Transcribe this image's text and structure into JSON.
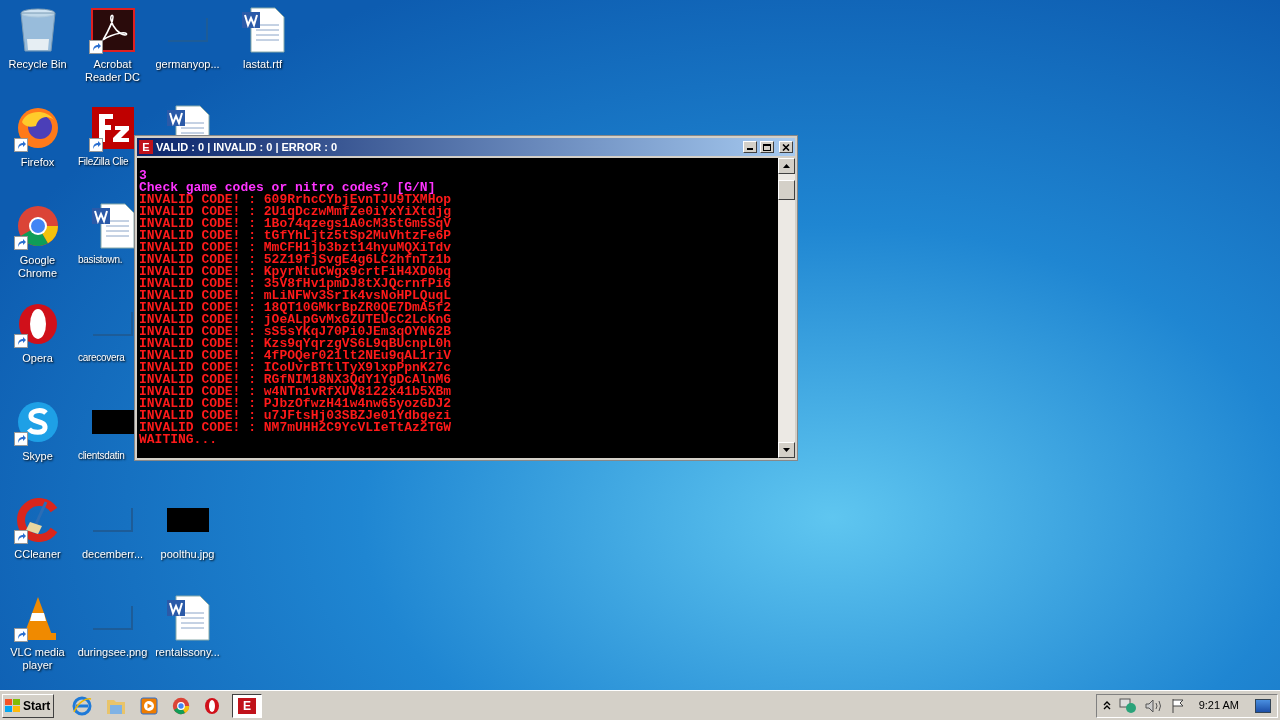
{
  "desktop": {
    "rows": [
      [
        {
          "kind": "recycle",
          "label": "Recycle Bin",
          "shortcut": false
        },
        {
          "kind": "pdf",
          "label": "Acrobat Reader DC",
          "shortcut": true
        },
        {
          "kind": "blank-thumb",
          "label": "germanyop..."
        },
        {
          "kind": "doc",
          "label": "lastat.rtf",
          "shortcut": false
        }
      ],
      [
        {
          "kind": "firefox",
          "label": "Firefox",
          "shortcut": true
        },
        {
          "kind": "fz",
          "label": "FileZilla Clie",
          "shortcut": true
        },
        {
          "kind": "doc",
          "shortcut": false
        },
        null
      ],
      [
        {
          "kind": "chrome",
          "label": "Google Chrome",
          "shortcut": true
        },
        {
          "kind": "doc",
          "label": "basistown.",
          "shortcut": false
        },
        null,
        null
      ],
      [
        {
          "kind": "opera",
          "label": "Opera",
          "shortcut": true
        },
        {
          "kind": "blank-thumb",
          "label": "carecovera"
        },
        null,
        null
      ],
      [
        {
          "kind": "skype",
          "label": "Skype",
          "shortcut": true
        },
        {
          "kind": "dark-thumb",
          "label": "clientsdatin"
        },
        null,
        null
      ],
      [
        {
          "kind": "ccleaner",
          "label": "CCleaner",
          "shortcut": true
        },
        {
          "kind": "blank-thumb",
          "label": "decemberr..."
        },
        {
          "kind": "dark-thumb",
          "label": "poolthu.jpg"
        },
        null
      ],
      [
        {
          "kind": "vlc",
          "label": "VLC media player",
          "shortcut": true
        },
        {
          "kind": "blank-thumb",
          "label": "duringsee.png"
        },
        {
          "kind": "doc",
          "label": "rentalssony...",
          "shortcut": false
        },
        null
      ]
    ]
  },
  "console": {
    "title_icon": "E",
    "title": "VALID : 0 | INVALID : 0 | ERROR : 0",
    "lines": [
      {
        "kind": "prompt",
        "text": "3"
      },
      {
        "kind": "prompt",
        "text": "Check game codes or nitro codes? [G/N]"
      },
      {
        "kind": "error",
        "text": "INVALID CODE! : 609RrhcCYbjEvnTJU9TXMHop"
      },
      {
        "kind": "error",
        "text": "INVALID CODE! : 2U1qDczwMmfZe0iYxYiXtdjg"
      },
      {
        "kind": "error",
        "text": "INVALID CODE! : 1Bo74qzegs1A0cM35tGm5SqV"
      },
      {
        "kind": "error",
        "text": "INVALID CODE! : tGfYhLjtz5tSp2MuVhtzFe6P"
      },
      {
        "kind": "error",
        "text": "INVALID CODE! : MmCFH1jb3bzt14hyuMQXiTdv"
      },
      {
        "kind": "error",
        "text": "INVALID CODE! : 52Z19fjSvgE4g6LC2hfnTz1b"
      },
      {
        "kind": "error",
        "text": "INVALID CODE! : KpyrNtuCWgx9crtFiH4XD0bq"
      },
      {
        "kind": "error",
        "text": "INVALID CODE! : 35V8fHv1pmDJ8tXJQcrnfPi6"
      },
      {
        "kind": "error",
        "text": "INVALID CODE! : mLiNFWv3SrIk4vsNoHPLQuqL"
      },
      {
        "kind": "error",
        "text": "INVALID CODE! : 18QT10GMkrBpZR0QE7DmA5f2"
      },
      {
        "kind": "error",
        "text": "INVALID CODE! : jOeALpGvMxGZUTEUcC2LcKnG"
      },
      {
        "kind": "error",
        "text": "INVALID CODE! : sS5sYKqJ70Pi0JEm3qOYN62B"
      },
      {
        "kind": "error",
        "text": "INVALID CODE! : Kzs9qYqrzgVS6L9qBUcnpL0h"
      },
      {
        "kind": "error",
        "text": "INVALID CODE! : 4fPOQer021lt2NEu9qAL1riV"
      },
      {
        "kind": "error",
        "text": "INVALID CODE! : ICoUvrBTtlTyX9lxpPpnK27c"
      },
      {
        "kind": "error",
        "text": "INVALID CODE! : RGfNIM18NX3QdY1YgDcAlnM6"
      },
      {
        "kind": "error",
        "text": "INVALID CODE! : w4NTn1vRfXUV8122x41b5XBm"
      },
      {
        "kind": "error",
        "text": "INVALID CODE! : PJbzOfwzH41w4nw65yozGDJ2"
      },
      {
        "kind": "error",
        "text": "INVALID CODE! : u7JFtsHj03SBZJe01Ydbgezi"
      },
      {
        "kind": "error",
        "text": "INVALID CODE! : NM7mUHH2C9YcVLIeTtAz2TGW"
      },
      {
        "kind": "error",
        "text": "WAITING..."
      }
    ]
  },
  "taskbar": {
    "start": "Start",
    "quick_launch": [
      {
        "kind": "ie"
      },
      {
        "kind": "folder"
      },
      {
        "kind": "media"
      },
      {
        "kind": "chrome"
      },
      {
        "kind": "opera"
      }
    ],
    "tasks": [
      {
        "label": "E",
        "selected": true
      }
    ],
    "tray": {
      "clock": "9:21 AM"
    }
  }
}
